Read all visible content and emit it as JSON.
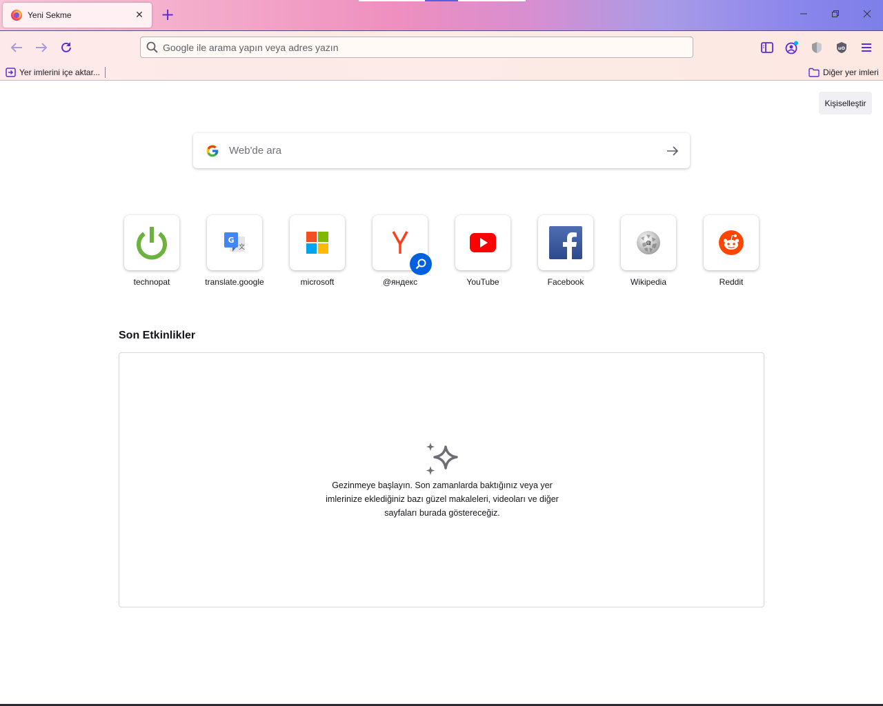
{
  "window": {
    "minimize_glyph": "—",
    "restore_glyph": "❐",
    "close_glyph": "✕"
  },
  "tab": {
    "title": "Yeni Sekme",
    "close_glyph": "✕",
    "favicon": "firefox-icon"
  },
  "new_tab_glyph": "+",
  "navbar": {
    "url_placeholder": "Google ile arama yapın veya adres yazın",
    "url_value": "",
    "icons": [
      "back-icon",
      "forward-icon",
      "reload-icon",
      "sidebar-icon",
      "account-icon",
      "shield-extension-icon",
      "ublock-icon",
      "menu-icon"
    ]
  },
  "bookmarks": {
    "import_label": "Yer imlerini içe aktar...",
    "other_label": "Diğer yer imleri"
  },
  "newtab": {
    "customize_label": "Kişiselleştir",
    "search_placeholder": "Web'de ara",
    "top_sites": [
      {
        "label": "technopat",
        "icon": "power-icon"
      },
      {
        "label": "translate.google",
        "icon": "google-translate-icon"
      },
      {
        "label": "microsoft",
        "icon": "microsoft-icon"
      },
      {
        "label": "@яндекс",
        "icon": "yandex-icon"
      },
      {
        "label": "YouTube",
        "icon": "youtube-icon"
      },
      {
        "label": "Facebook",
        "icon": "facebook-icon"
      },
      {
        "label": "Wikipedia",
        "icon": "wikipedia-icon"
      },
      {
        "label": "Reddit",
        "icon": "reddit-icon"
      }
    ],
    "recent_title": "Son Etkinlikler",
    "recent_empty_message": "Gezinmeye başlayın. Son zamanlarda baktığınız veya yer imlerinize eklediğiniz bazı güzel makaleleri, videoları ve diğer sayfaları burada göstereceğiz."
  },
  "colors": {
    "accent": "#5b2bd8",
    "search_badge": "#0061e0"
  }
}
